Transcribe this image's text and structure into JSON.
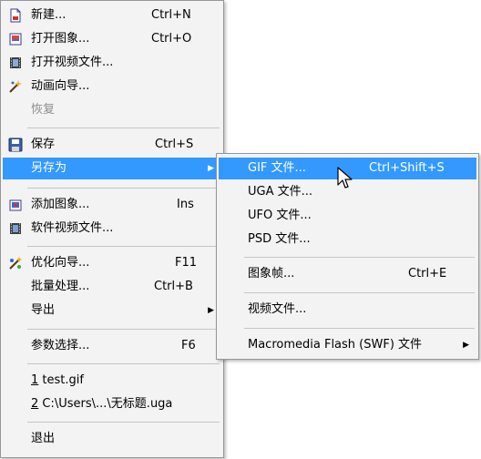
{
  "main_menu": {
    "new": {
      "label": "新建...",
      "shortcut": "Ctrl+N",
      "icon": "new-file-icon"
    },
    "open_image": {
      "label": "打开图象...",
      "shortcut": "Ctrl+O",
      "icon": "open-image-icon"
    },
    "open_video": {
      "label": "打开视频文件...",
      "icon": "video-file-icon"
    },
    "animation_wizard": {
      "label": "动画向导...",
      "icon": "wizard-wand-icon"
    },
    "restore": {
      "label": "恢复",
      "disabled": true
    },
    "save": {
      "label": "保存",
      "shortcut": "Ctrl+S",
      "icon": "save-disk-icon"
    },
    "save_as": {
      "label": "另存为",
      "highlighted": true
    },
    "add_image": {
      "label": "添加图象...",
      "shortcut": "Ins",
      "icon": "add-image-icon"
    },
    "software_video": {
      "label": "软件视频文件...",
      "icon": "film-icon"
    },
    "optimize_wizard": {
      "label": "优化向导...",
      "shortcut": "F11",
      "icon": "optimize-icon"
    },
    "batch": {
      "label": "批量处理...",
      "shortcut": "Ctrl+B"
    },
    "export": {
      "label": "导出"
    },
    "preferences": {
      "label": "参数选择...",
      "shortcut": "F6"
    },
    "recent": [
      {
        "num": "1",
        "name": " test.gif"
      },
      {
        "num": "2",
        "name": " C:\\Users\\...\\无标题.uga"
      }
    ],
    "exit": {
      "label": "退出"
    }
  },
  "save_as_menu": {
    "gif": {
      "label": "GIF 文件...",
      "shortcut": "Ctrl+Shift+S",
      "highlighted": true
    },
    "uga": {
      "label": "UGA 文件..."
    },
    "ufo": {
      "label": "UFO 文件..."
    },
    "psd": {
      "label": "PSD 文件..."
    },
    "frame": {
      "label": "图象帧...",
      "shortcut": "Ctrl+E"
    },
    "video": {
      "label": "视频文件..."
    },
    "flash": {
      "label": "Macromedia Flash (SWF) 文件"
    }
  },
  "colors": {
    "highlight": "#3399ff",
    "menu_bg": "#f3f3f3",
    "disabled_text": "#8d8d8d"
  }
}
